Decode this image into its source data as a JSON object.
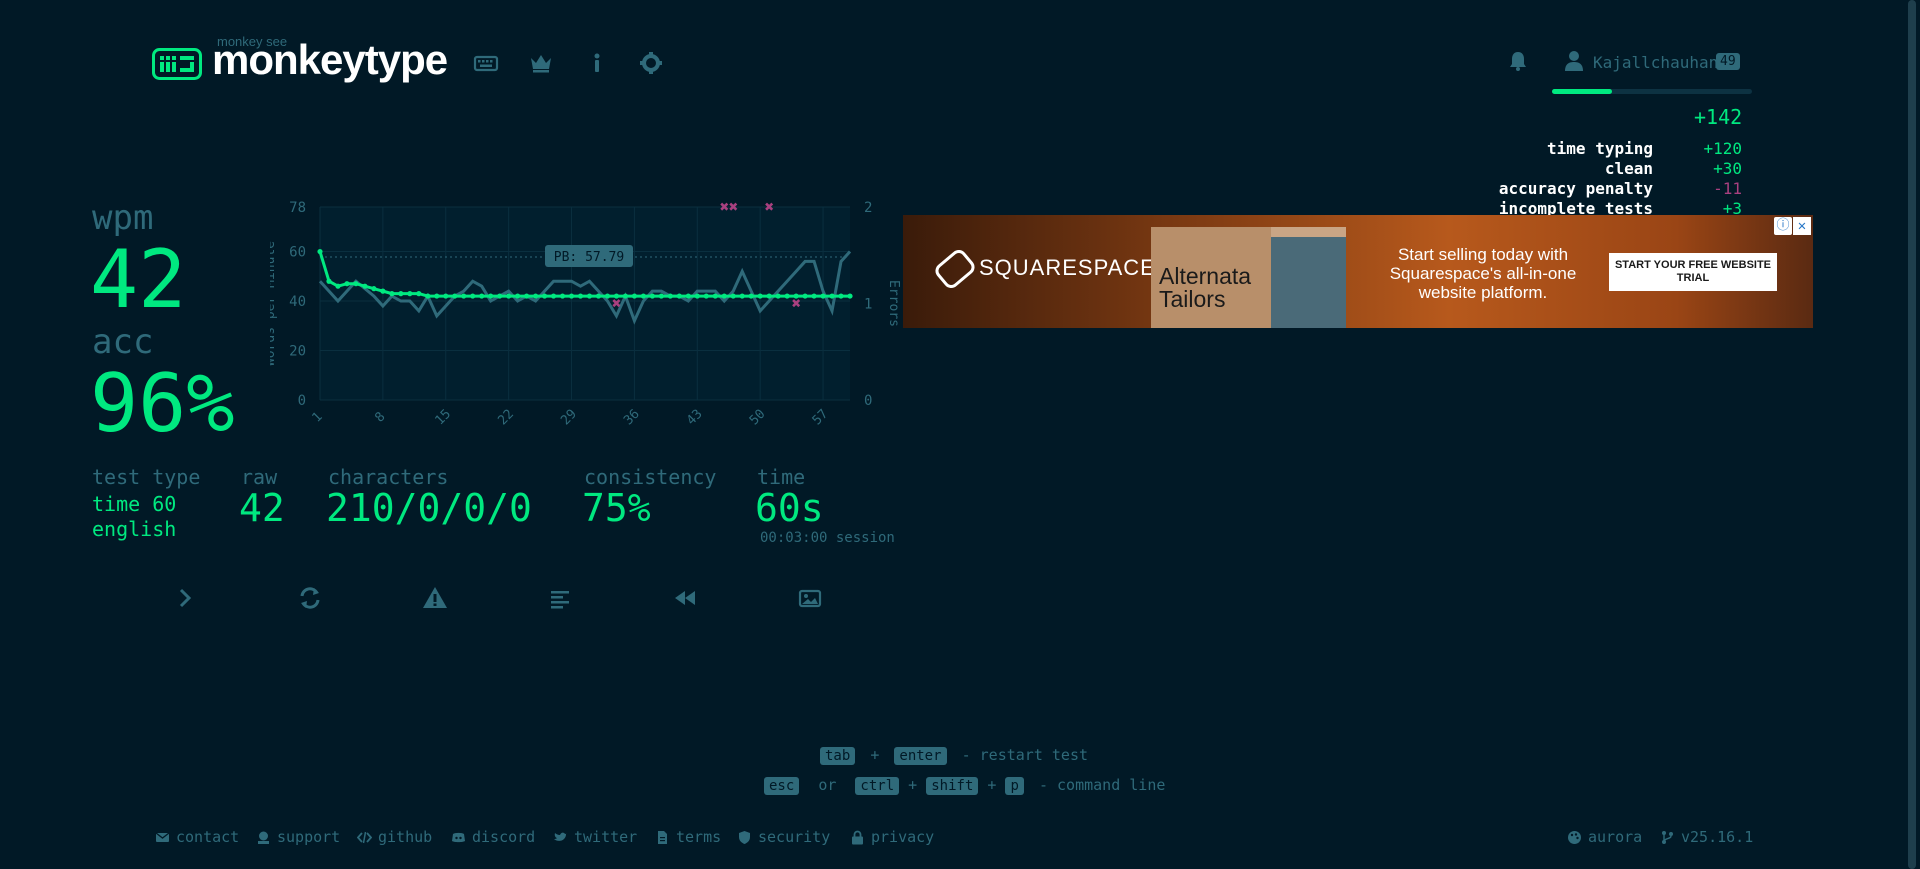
{
  "header": {
    "logo_small": "monkey see",
    "logo_text": "monkeytype",
    "username": "Kajallchauhan",
    "level": "49",
    "xp_fraction": 0.3
  },
  "xp": {
    "total": "+142",
    "rows": [
      {
        "label": "time typing",
        "value": "+120",
        "kind": "pos"
      },
      {
        "label": "clean",
        "value": "+30",
        "kind": "pos"
      },
      {
        "label": "accuracy penalty",
        "value": "-11",
        "kind": "neg"
      },
      {
        "label": "incomplete tests",
        "value": "+3",
        "kind": "pos"
      }
    ]
  },
  "ad": {
    "logo": "SQUARESPACE",
    "photo_text": "Alternata Tailors",
    "headline": "Start selling today with Squarespace's all-in-one website platform.",
    "cta": "START YOUR FREE WEBSITE TRIAL",
    "info": "ⓘ",
    "close": "✕"
  },
  "stats": {
    "wpm_label": "wpm",
    "wpm": "42",
    "acc_label": "acc",
    "acc": "96%",
    "test_type_label": "test type",
    "test_type_line1": "time 60",
    "test_type_line2": "english",
    "raw_label": "raw",
    "raw": "42",
    "characters_label": "characters",
    "characters": "210/0/0/0",
    "consistency_label": "consistency",
    "consistency": "75%",
    "time_label": "time",
    "time": "60s",
    "session": "00:03:00 session"
  },
  "chart_data": {
    "type": "line",
    "ylabel": "Words per Minute",
    "y2label": "Errors",
    "ylim": [
      0,
      78
    ],
    "y2lim": [
      0,
      2
    ],
    "yticks": [
      "0",
      "20",
      "40",
      "60",
      "78"
    ],
    "y2ticks": [
      "0",
      "1",
      "2"
    ],
    "xticks": [
      "1",
      "8",
      "15",
      "22",
      "29",
      "36",
      "43",
      "50",
      "57"
    ],
    "pb_label": "PB: 57.79",
    "pb_value": 57.79,
    "series": [
      {
        "values": [
          60,
          48,
          46,
          47,
          47,
          46,
          45,
          44,
          43,
          43,
          43,
          43,
          42,
          42,
          42,
          42,
          42,
          42,
          42,
          42,
          42,
          42,
          42,
          42,
          42,
          42,
          42,
          42,
          42,
          42,
          42,
          42,
          42,
          42,
          42,
          42,
          42,
          42,
          42,
          42,
          42,
          42,
          42,
          42,
          42,
          42,
          42,
          42,
          42,
          42,
          42,
          42,
          42,
          42,
          42,
          42,
          42,
          42,
          42,
          42
        ]
      },
      {
        "values": [
          48,
          44,
          40,
          44,
          48,
          45,
          42,
          38,
          42,
          40,
          40,
          36,
          42,
          34,
          38,
          42,
          44,
          48,
          46,
          40,
          42,
          44,
          40,
          42,
          40,
          44,
          48,
          48,
          48,
          46,
          48,
          44,
          40,
          34,
          42,
          32,
          40,
          44,
          44,
          42,
          42,
          40,
          44,
          44,
          44,
          40,
          44,
          52,
          44,
          36,
          40,
          44,
          48,
          52,
          56,
          56,
          44,
          36,
          56,
          60
        ]
      }
    ],
    "errors": [
      {
        "x": 46,
        "y": 2
      },
      {
        "x": 47,
        "y": 2
      },
      {
        "x": 51,
        "y": 2
      },
      {
        "x": 34,
        "y": 1
      },
      {
        "x": 54,
        "y": 1
      }
    ]
  },
  "hints": {
    "tab": "tab",
    "plus": "+",
    "enter": "enter",
    "restart": "- restart test",
    "esc": "esc",
    "or": "or",
    "ctrl": "ctrl",
    "shift": "shift",
    "p": "p",
    "command": "- command line"
  },
  "footer": {
    "contact": "contact",
    "support": "support",
    "github": "github",
    "discord": "discord",
    "twitter": "twitter",
    "terms": "terms",
    "security": "security",
    "privacy": "privacy",
    "theme": "aurora",
    "version": "v25.16.1"
  },
  "colors": {
    "bg": "#011926",
    "main": "#00e980",
    "sub": "#2f6a7a",
    "text": "#ffffff",
    "error": "#a8407f"
  }
}
